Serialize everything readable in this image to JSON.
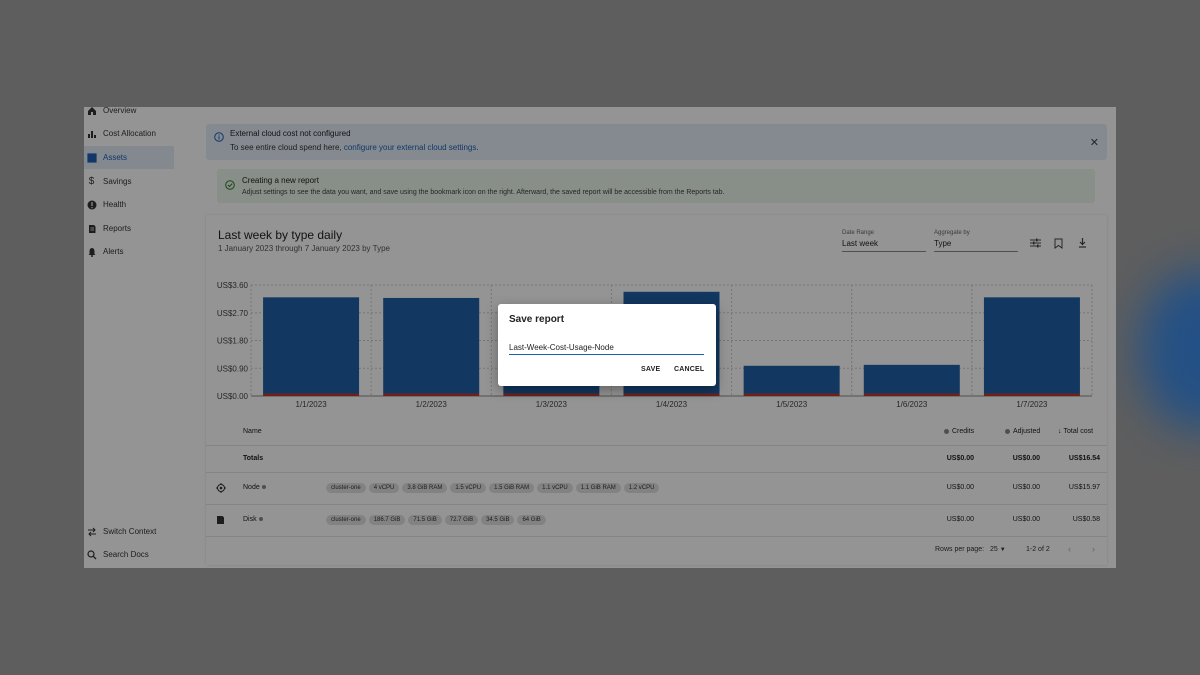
{
  "sidebar": {
    "items": [
      {
        "label": "Overview",
        "icon": "home-icon"
      },
      {
        "label": "Cost Allocation",
        "icon": "bar-chart-icon"
      },
      {
        "label": "Assets",
        "icon": "grid-icon",
        "active": true
      },
      {
        "label": "Savings",
        "icon": "dollar-icon"
      },
      {
        "label": "Health",
        "icon": "alert-circle-icon"
      },
      {
        "label": "Reports",
        "icon": "document-icon"
      },
      {
        "label": "Alerts",
        "icon": "bell-icon"
      }
    ],
    "bottom": [
      {
        "label": "Switch Context",
        "icon": "swap-icon"
      },
      {
        "label": "Search Docs",
        "icon": "search-icon"
      }
    ]
  },
  "banner_info": {
    "title": "External cloud cost not configured",
    "text": "To see entire cloud spend here, ",
    "link": "configure your external cloud settings",
    "text_end": "."
  },
  "banner_ok": {
    "title": "Creating a new report",
    "text": "Adjust settings to see the data you want, and save using the bookmark icon on the right. Afterward, the saved report will be accessible from the Reports tab."
  },
  "report": {
    "title": "Last week by type daily",
    "subtitle": "1 January 2023 through 7 January 2023 by Type",
    "date_range_label": "Date Range",
    "date_range_value": "Last week",
    "aggregate_label": "Aggregate by",
    "aggregate_value": "Type"
  },
  "chart_data": {
    "type": "bar",
    "categories": [
      "1/1/2023",
      "1/2/2023",
      "1/3/2023",
      "1/4/2023",
      "1/5/2023",
      "1/6/2023",
      "1/7/2023"
    ],
    "series": [
      {
        "name": "Node",
        "color": "#1f5fa6",
        "values": [
          3.12,
          3.1,
          2.82,
          3.3,
          0.9,
          0.93,
          3.12
        ]
      },
      {
        "name": "Disk",
        "color": "#c0392b",
        "values": [
          0.08,
          0.08,
          0.08,
          0.08,
          0.08,
          0.08,
          0.08
        ]
      }
    ],
    "ylim": [
      0,
      3.6
    ],
    "yticks": [
      "US$0.00",
      "US$0.90",
      "US$1.80",
      "US$2.70",
      "US$3.60"
    ],
    "grid": true
  },
  "table": {
    "headers": {
      "name": "Name",
      "credits": "Credits",
      "adjusted": "Adjusted",
      "total": "Total cost"
    },
    "totals": {
      "label": "Totals",
      "credits": "US$0.00",
      "adjusted": "US$0.00",
      "total": "US$16.54"
    },
    "rows": [
      {
        "name": "Node",
        "icon": "node-icon",
        "chips": [
          "cluster-one",
          "4 vCPU",
          "3.8 GiB RAM",
          "1.5 vCPU",
          "1.5 GiB RAM",
          "1.1 vCPU",
          "1.1 GiB RAM",
          "1.2 vCPU"
        ],
        "credits": "US$0.00",
        "adjusted": "US$0.00",
        "total": "US$15.97"
      },
      {
        "name": "Disk",
        "icon": "disk-icon",
        "chips": [
          "cluster-one",
          "186.7 GiB",
          "71.5 GiB",
          "72.7 GiB",
          "34.5 GiB",
          "64 GiB"
        ],
        "credits": "US$0.00",
        "adjusted": "US$0.00",
        "total": "US$0.58"
      }
    ],
    "rows_per_page_label": "Rows per page:",
    "rows_per_page": "25",
    "range": "1-2 of 2"
  },
  "dialog": {
    "title": "Save report",
    "input_value": "Last-Week-Cost-Usage-Node",
    "save": "SAVE",
    "cancel": "CANCEL"
  }
}
